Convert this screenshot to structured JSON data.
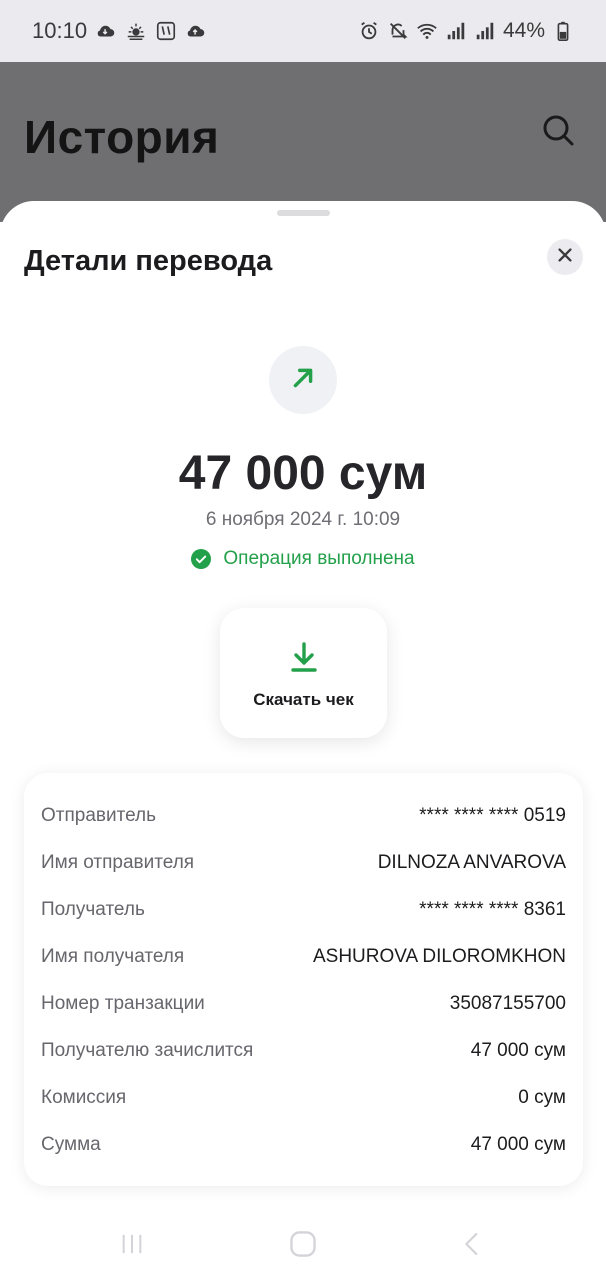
{
  "status_bar": {
    "time": "10:10",
    "battery": "44%",
    "left_icons": [
      "cloud-icon",
      "weather-icon",
      "app-icon",
      "cloud-upload-icon"
    ],
    "right_icons": [
      "alarm-icon",
      "mute-icon",
      "wifi-icon",
      "signal-icon",
      "signal-icon",
      "battery-icon"
    ]
  },
  "background_page": {
    "title": "История",
    "search_icon": "search-icon"
  },
  "sheet": {
    "title": "Детали перевода",
    "close_icon": "close-icon",
    "transfer_icon": "arrow-up-right-icon",
    "amount": "47 000 сум",
    "datetime": "6 ноября 2024 г. 10:09",
    "status": "Операция выполнена",
    "status_icon": "check-circle-icon",
    "download": {
      "label": "Скачать чек",
      "icon": "download-icon"
    },
    "details": [
      {
        "label": "Отправитель",
        "value": "**** **** **** 0519"
      },
      {
        "label": "Имя отправителя",
        "value": "DILNOZA ANVAROVA"
      },
      {
        "label": "Получатель",
        "value": "**** **** **** 8361"
      },
      {
        "label": "Имя получателя",
        "value": "ASHUROVA DILOROMKHON"
      },
      {
        "label": "Номер транзакции",
        "value": "35087155700"
      },
      {
        "label": "Получателю зачислится",
        "value": "47 000 сум"
      },
      {
        "label": "Комиссия",
        "value": "0 сум"
      },
      {
        "label": "Сумма",
        "value": "47 000 сум"
      }
    ]
  },
  "nav_bar": {
    "icons": [
      "recent-apps-icon",
      "home-icon",
      "back-icon"
    ]
  },
  "colors": {
    "accent_green": "#23a04a",
    "overlay": "#6f6f71",
    "status_bar_bg": "#ebebef"
  }
}
